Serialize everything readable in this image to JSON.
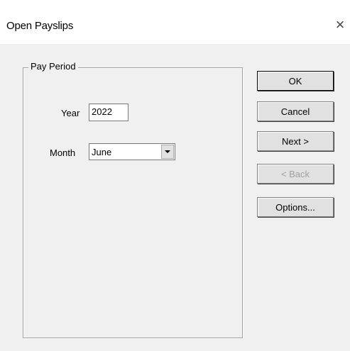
{
  "window": {
    "title": "Open Payslips",
    "close_glyph": "×"
  },
  "pay_period": {
    "group_label": "Pay Period",
    "year_label": "Year",
    "year_value": "2022",
    "month_label": "Month",
    "month_selected": "June"
  },
  "buttons": {
    "ok": "OK",
    "cancel": "Cancel",
    "next": "Next >",
    "back": "< Back",
    "options": "Options..."
  },
  "states": {
    "back_enabled": false
  },
  "colors": {
    "dialog_background": "#f0f0f0",
    "disabled_text": "#a0a0a0"
  }
}
